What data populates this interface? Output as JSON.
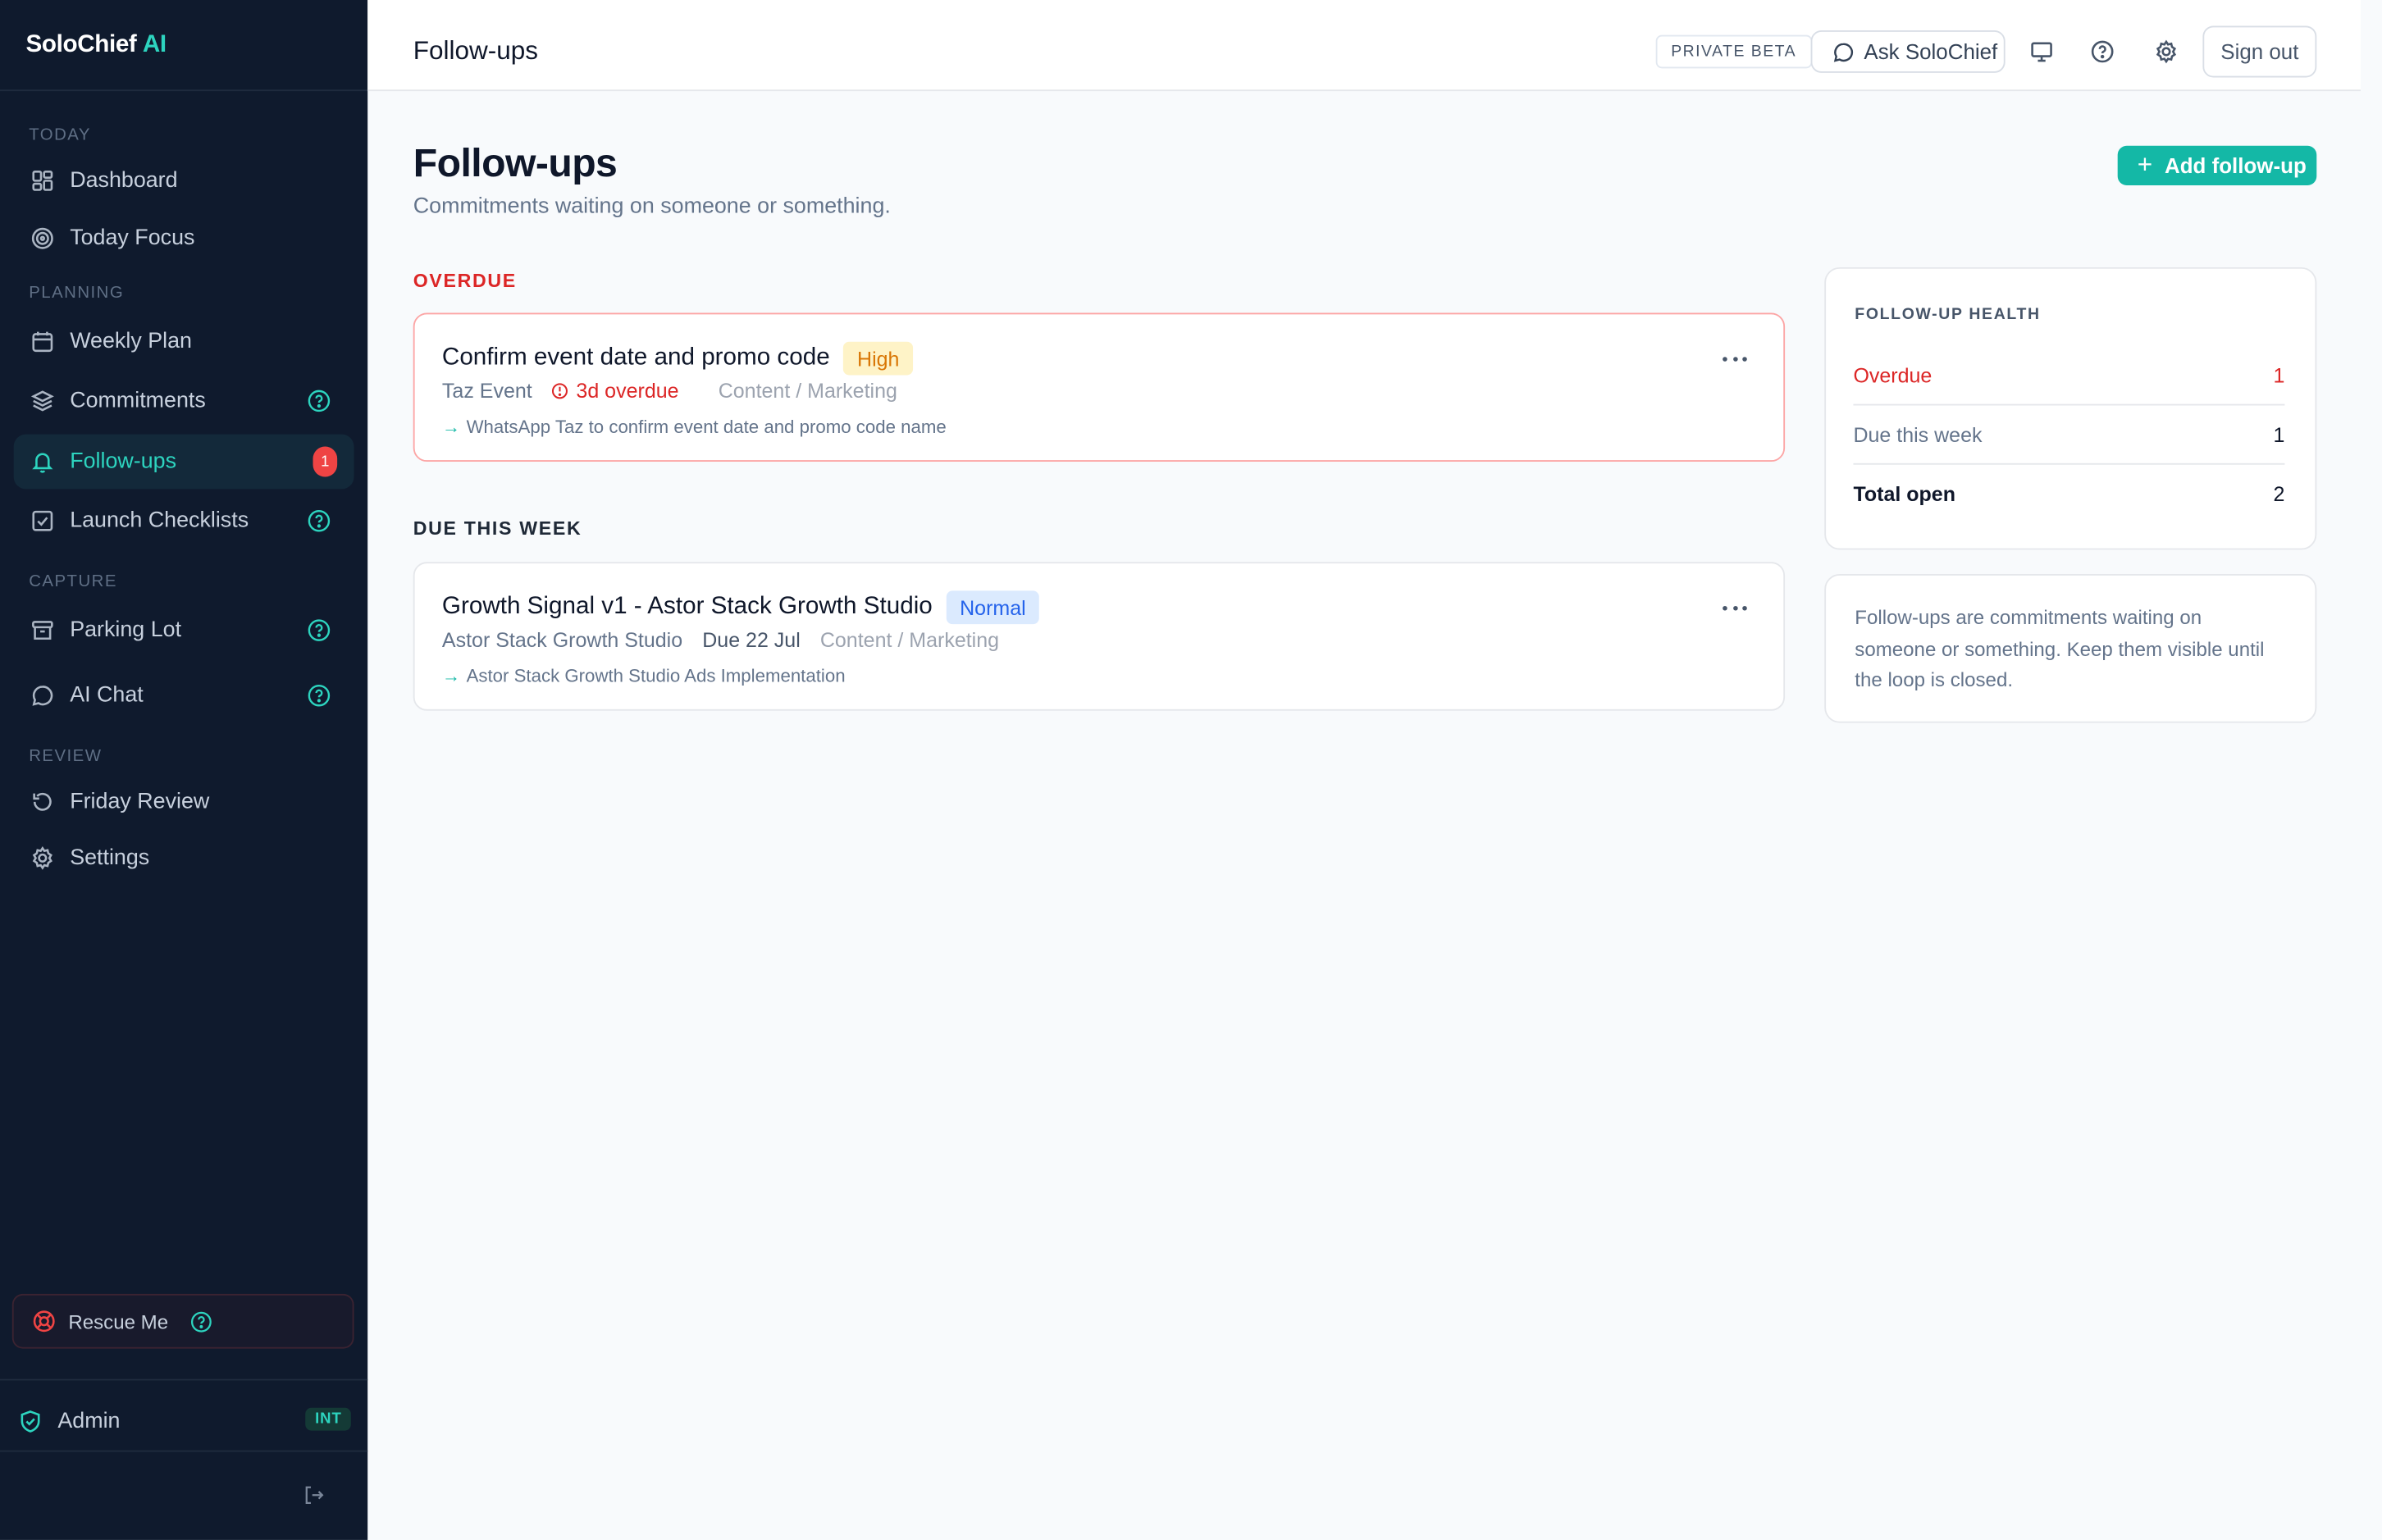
{
  "brand": {
    "name": "SoloChief",
    "accent": "AI"
  },
  "sidebar": {
    "sections": {
      "today": "TODAY",
      "planning": "PLANNING",
      "capture": "CAPTURE",
      "review": "REVIEW"
    },
    "items": [
      {
        "label": "Dashboard",
        "icon": "grid-icon"
      },
      {
        "label": "Today Focus",
        "icon": "target-icon"
      },
      {
        "label": "Weekly Plan",
        "icon": "calendar-icon"
      },
      {
        "label": "Commitments",
        "icon": "layers-icon"
      },
      {
        "label": "Follow-ups",
        "icon": "bell-icon",
        "badge": "1",
        "active": true
      },
      {
        "label": "Launch Checklists",
        "icon": "checkbox-icon"
      },
      {
        "label": "Parking Lot",
        "icon": "archive-icon"
      },
      {
        "label": "AI Chat",
        "icon": "chat-icon"
      },
      {
        "label": "Friday Review",
        "icon": "refresh-icon"
      },
      {
        "label": "Settings",
        "icon": "gear-icon"
      }
    ],
    "rescue_label": "Rescue Me",
    "admin": {
      "label": "Admin",
      "tag": "INT"
    }
  },
  "topbar": {
    "title": "Follow-ups",
    "beta": "PRIVATE BETA",
    "ask": "Ask SoloChief",
    "signout": "Sign out"
  },
  "page": {
    "title": "Follow-ups",
    "subtitle": "Commitments waiting on someone or something.",
    "add_button": "Add follow-up"
  },
  "groups": {
    "overdue": {
      "label": "OVERDUE",
      "item": {
        "title": "Confirm event date and promo code",
        "priority": "High",
        "project": "Taz Event",
        "status": "3d overdue",
        "category": "Content / Marketing",
        "next": "WhatsApp Taz to confirm event date and promo code name"
      }
    },
    "week": {
      "label": "DUE THIS WEEK",
      "item": {
        "title": "Growth Signal v1 - Astor Stack Growth Studio",
        "priority": "Normal",
        "project": "Astor Stack Growth Studio",
        "due": "Due 22 Jul",
        "category": "Content / Marketing",
        "next": "Astor Stack Growth Studio Ads Implementation"
      }
    }
  },
  "health": {
    "title": "FOLLOW-UP HEALTH",
    "overdue_label": "Overdue",
    "overdue_value": "1",
    "week_label": "Due this week",
    "week_value": "1",
    "total_label": "Total open",
    "total_value": "2"
  },
  "note": "Follow-ups are commitments waiting on someone or something. Keep them visible until the loop is closed.",
  "colors": {
    "accent": "#14b8a6",
    "sidebar_bg": "#0f1a2d",
    "danger": "#dc2626",
    "warning": "#d97706",
    "info": "#2563eb"
  }
}
